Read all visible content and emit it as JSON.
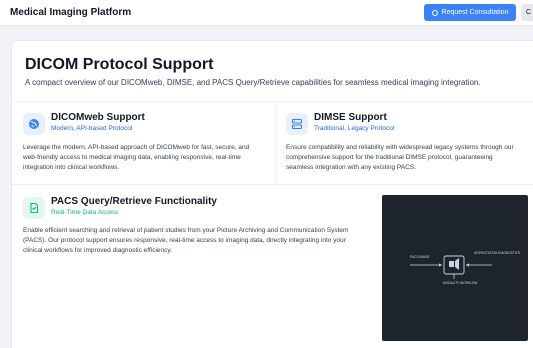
{
  "header": {
    "brand": "Medical Imaging Platform",
    "cta_label": "Request Consultation",
    "edge_label": "C"
  },
  "main": {
    "title": "DICOM Protocol Support",
    "subtitle": "A compact overview of our DICOMweb, DIMSE, and PACS Query/Retrieve capabilities for seamless medical imaging integration.",
    "features": [
      {
        "title": "DICOMweb Support",
        "subtitle": "Modern, API-based Protocol",
        "icon": "globe-icon",
        "desc_lines": [
          "Leverage the modern, API-based approach of DICOMweb for fast, secure, and",
          "web-friendly access to medical imaging data, enabling responsive, real-time",
          "integration into clinical workflows."
        ]
      },
      {
        "title": "DIMSE Support",
        "subtitle": "Traditional, Legacy Protocol",
        "icon": "server-icon",
        "desc_lines": [
          "Ensure compatibility and reliability with widespread legacy systems through our",
          "comprehensive support for the traditional DIMSE protocol, guaranteeing",
          "seamless integration with any existing PACS."
        ]
      },
      {
        "title": "PACS Query/Retrieve Functionality",
        "subtitle": "Real-Time Data Access",
        "icon": "document-icon",
        "desc_lines": [
          "Enable efficient searching and retrieval of patient studies from your Picture Archiving and Communication System",
          "(PACS). Our protocol support ensures responsive, real-time access to imaging data, directly integrating into your",
          "clinical workflows for improved diagnostic efficiency."
        ]
      }
    ],
    "diagram": {
      "left_label": "PACS IMAGE",
      "right_label": "WORKSTATION DIAGNOSTICS",
      "bottom_label": "MODALITY WORKLOW"
    }
  },
  "colors": {
    "accent": "#3b82f6",
    "subtitle_blue": "#2563eb",
    "subtitle_green": "#10b981"
  }
}
